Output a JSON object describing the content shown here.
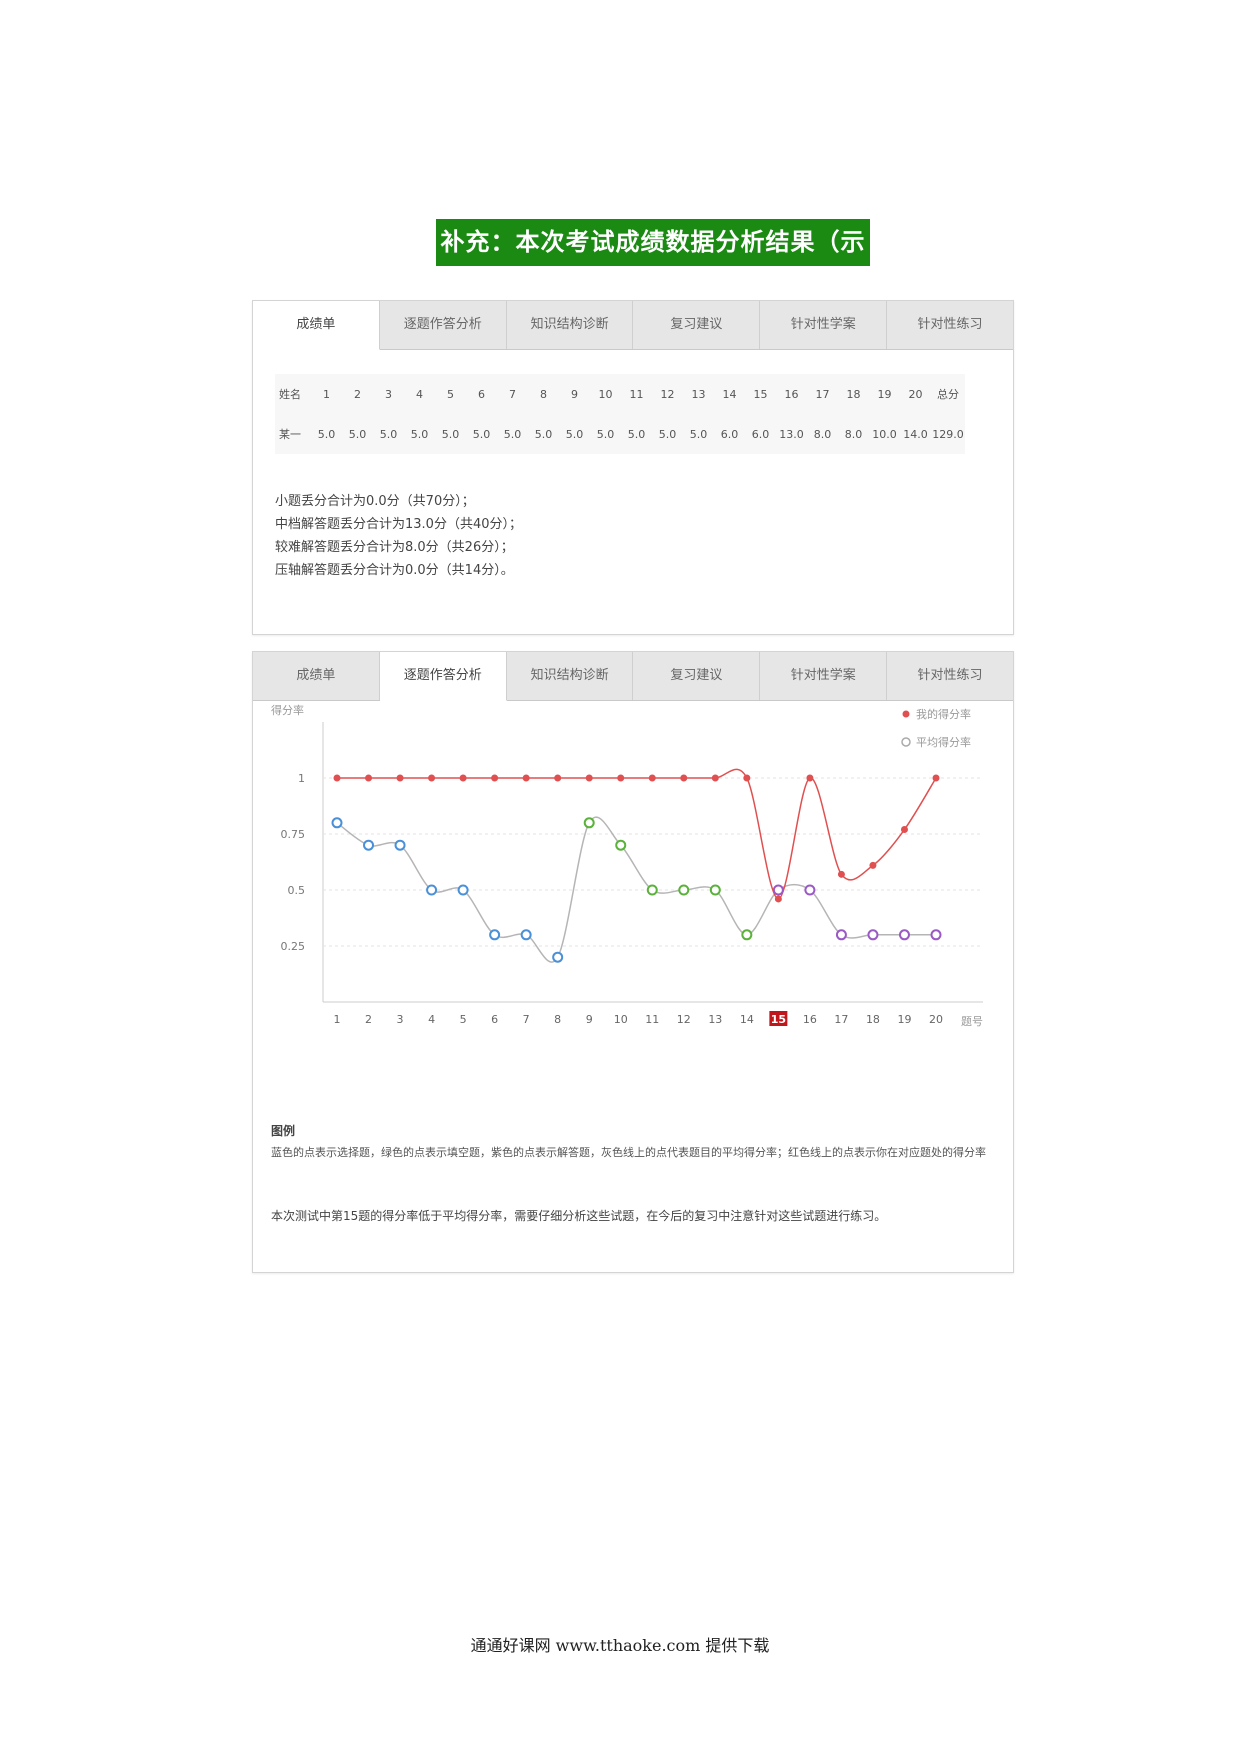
{
  "banner": "补充：本次考试成绩数据分析结果（示例）:",
  "tabs": [
    "成绩单",
    "逐题作答分析",
    "知识结构诊断",
    "复习建议",
    "针对性学案",
    "针对性练习"
  ],
  "panel1": {
    "active_tab": 0,
    "table": {
      "header": [
        "姓名",
        "1",
        "2",
        "3",
        "4",
        "5",
        "6",
        "7",
        "8",
        "9",
        "10",
        "11",
        "12",
        "13",
        "14",
        "15",
        "16",
        "17",
        "18",
        "19",
        "20",
        "总分"
      ],
      "row": [
        "某一",
        "5.0",
        "5.0",
        "5.0",
        "5.0",
        "5.0",
        "5.0",
        "5.0",
        "5.0",
        "5.0",
        "5.0",
        "5.0",
        "5.0",
        "5.0",
        "6.0",
        "6.0",
        "13.0",
        "8.0",
        "8.0",
        "10.0",
        "14.0",
        "129.0"
      ]
    },
    "notes": [
      "小题丢分合计为0.0分（共70分）；",
      "中档解答题丢分合计为13.0分（共40分）；",
      "较难解答题丢分合计为8.0分（共26分）；",
      "压轴解答题丢分合计为0.0分（共14分）。"
    ]
  },
  "panel2": {
    "active_tab": 1,
    "legend_title": "图例",
    "legend_text": "蓝色的点表示选择题，绿色的点表示填空题，紫色的点表示解答题，灰色线上的点代表题目的平均得分率；红色线上的点表示你在对应题处的得分率",
    "conclusion": "本次测试中第15题的得分率低于平均得分率，需要仔细分析这些试题，在今后的复习中注意针对这些试题进行练习。"
  },
  "chart_data": {
    "type": "line",
    "ylabel": "得分率",
    "xlabel": "题号",
    "x": [
      1,
      2,
      3,
      4,
      5,
      6,
      7,
      8,
      9,
      10,
      11,
      12,
      13,
      14,
      15,
      16,
      17,
      18,
      19,
      20
    ],
    "ylim": [
      0,
      1.25
    ],
    "yticks": [
      "0.25",
      "0.5",
      "0.75",
      "1"
    ],
    "highlight_x": 15,
    "series": [
      {
        "name": "我的得分率",
        "color": "#e05050",
        "values": [
          1,
          1,
          1,
          1,
          1,
          1,
          1,
          1,
          1,
          1,
          1,
          1,
          1,
          1,
          0.46,
          1,
          0.57,
          0.61,
          0.77,
          1
        ]
      },
      {
        "name": "平均得分率",
        "color": "#b5b5b5",
        "values": [
          0.8,
          0.7,
          0.7,
          0.5,
          0.5,
          0.3,
          0.3,
          0.2,
          0.8,
          0.7,
          0.5,
          0.5,
          0.5,
          0.3,
          0.5,
          0.5,
          0.3,
          0.3,
          0.3,
          0.3
        ]
      }
    ],
    "point_colors": {
      "choice": "#4a90d9",
      "fill": "#5ab23a",
      "answer": "#9b59c6"
    },
    "point_type_by_question": [
      "choice",
      "choice",
      "choice",
      "choice",
      "choice",
      "choice",
      "choice",
      "choice",
      "fill",
      "fill",
      "fill",
      "fill",
      "fill",
      "fill",
      "answer",
      "answer",
      "answer",
      "answer",
      "answer",
      "answer"
    ],
    "legend_position": "top-right",
    "grid": true
  },
  "footer": "通通好课网  www.tthaoke.com  提供下载"
}
